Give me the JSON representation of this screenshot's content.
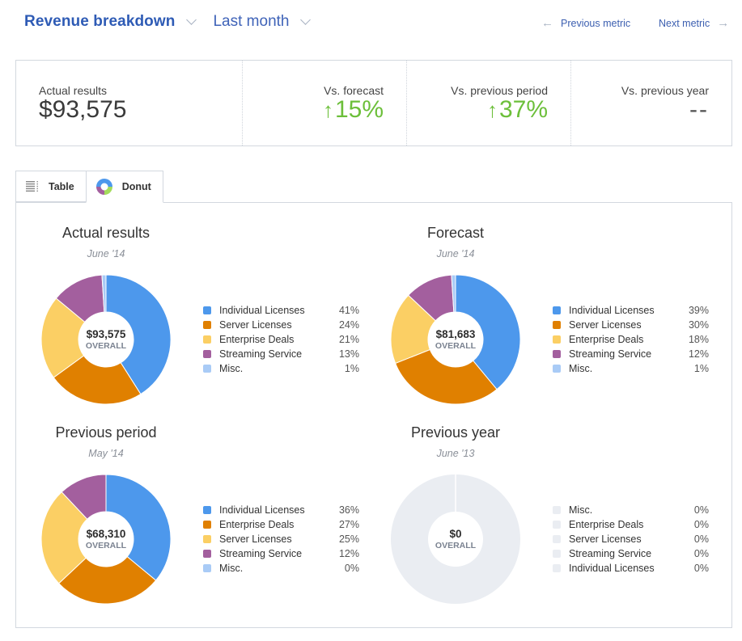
{
  "header": {
    "title": "Revenue breakdown",
    "period": "Last month",
    "prev_metric": "Previous metric",
    "next_metric": "Next metric"
  },
  "summary": [
    {
      "label": "Actual results",
      "value": "$93,575",
      "trend": "none"
    },
    {
      "label": "Vs. forecast",
      "value": "15%",
      "trend": "up"
    },
    {
      "label": "Vs. previous period",
      "value": "37%",
      "trend": "up"
    },
    {
      "label": "Vs. previous year",
      "value": "--",
      "trend": "none"
    }
  ],
  "tabs": [
    {
      "label": "Table",
      "icon": "table-icon",
      "active": false
    },
    {
      "label": "Donut",
      "icon": "donut-icon",
      "active": true
    }
  ],
  "colors": {
    "Individual Licenses": "#4d98ec",
    "Server Licenses": "#e08000",
    "Enterprise Deals": "#fbcf64",
    "Streaming Service": "#a35f9e",
    "Misc.": "#a9cbf6",
    "empty": "#eaedf2",
    "accent": "#2e5bb5",
    "positive": "#6cbf3a"
  },
  "center_caption": "OVERALL",
  "chart_data": [
    {
      "type": "pie",
      "title": "Actual results",
      "subtitle": "June '14",
      "total": "$93,575",
      "slices": [
        {
          "label": "Individual Licenses",
          "value": 41,
          "color_key": "Individual Licenses"
        },
        {
          "label": "Server Licenses",
          "value": 24,
          "color_key": "Server Licenses"
        },
        {
          "label": "Enterprise Deals",
          "value": 21,
          "color_key": "Enterprise Deals"
        },
        {
          "label": "Streaming Service",
          "value": 13,
          "color_key": "Streaming Service"
        },
        {
          "label": "Misc.",
          "value": 1,
          "color_key": "Misc."
        }
      ]
    },
    {
      "type": "pie",
      "title": "Forecast",
      "subtitle": "June '14",
      "total": "$81,683",
      "slices": [
        {
          "label": "Individual Licenses",
          "value": 39,
          "color_key": "Individual Licenses"
        },
        {
          "label": "Server Licenses",
          "value": 30,
          "color_key": "Server Licenses"
        },
        {
          "label": "Enterprise Deals",
          "value": 18,
          "color_key": "Enterprise Deals"
        },
        {
          "label": "Streaming Service",
          "value": 12,
          "color_key": "Streaming Service"
        },
        {
          "label": "Misc.",
          "value": 1,
          "color_key": "Misc."
        }
      ]
    },
    {
      "type": "pie",
      "title": "Previous period",
      "subtitle": "May '14",
      "total": "$68,310",
      "slices": [
        {
          "label": "Individual Licenses",
          "value": 36,
          "color_key": "Individual Licenses"
        },
        {
          "label": "Enterprise Deals",
          "value": 27,
          "color_key": "Server Licenses"
        },
        {
          "label": "Server Licenses",
          "value": 25,
          "color_key": "Enterprise Deals"
        },
        {
          "label": "Streaming Service",
          "value": 12,
          "color_key": "Streaming Service"
        },
        {
          "label": "Misc.",
          "value": 0,
          "color_key": "Misc."
        }
      ]
    },
    {
      "type": "pie",
      "title": "Previous year",
      "subtitle": "June '13",
      "total": "$0",
      "slices": [
        {
          "label": "Misc.",
          "value": 0,
          "color_key": "empty"
        },
        {
          "label": "Enterprise Deals",
          "value": 0,
          "color_key": "empty"
        },
        {
          "label": "Server Licenses",
          "value": 0,
          "color_key": "empty"
        },
        {
          "label": "Streaming Service",
          "value": 0,
          "color_key": "empty"
        },
        {
          "label": "Individual Licenses",
          "value": 0,
          "color_key": "empty"
        }
      ]
    }
  ]
}
